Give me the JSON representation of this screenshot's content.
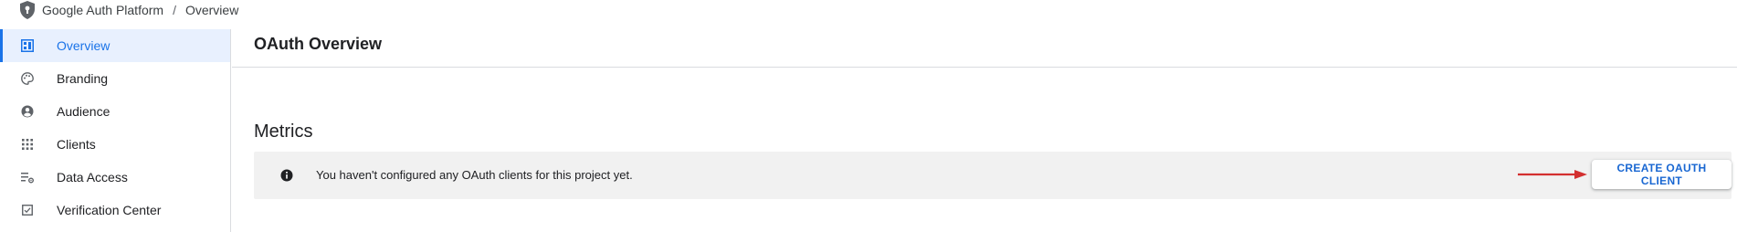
{
  "breadcrumb": {
    "product": "Google Auth Platform",
    "separator": "/",
    "current": "Overview",
    "icon": "shield-keyhole-icon"
  },
  "sidebar": {
    "items": [
      {
        "label": "Overview",
        "icon": "dashboard-icon",
        "active": true
      },
      {
        "label": "Branding",
        "icon": "palette-icon",
        "active": false
      },
      {
        "label": "Audience",
        "icon": "account-circle-icon",
        "active": false
      },
      {
        "label": "Clients",
        "icon": "apps-grid-icon",
        "active": false
      },
      {
        "label": "Data Access",
        "icon": "list-settings-icon",
        "active": false
      },
      {
        "label": "Verification Center",
        "icon": "verification-checkbox-icon",
        "active": false
      }
    ]
  },
  "main": {
    "title": "OAuth Overview",
    "section_title": "Metrics",
    "banner": {
      "message": "You haven't configured any OAuth clients for this project yet.",
      "icon": "info-icon",
      "button_label": "CREATE OAUTH CLIENT"
    }
  },
  "colors": {
    "accent": "#1a73e8",
    "active_bg": "#e8f0fe",
    "banner_bg": "#f1f1f1",
    "button_text": "#1967d2",
    "arrow": "#d32f2f",
    "divider": "#dadce0"
  }
}
